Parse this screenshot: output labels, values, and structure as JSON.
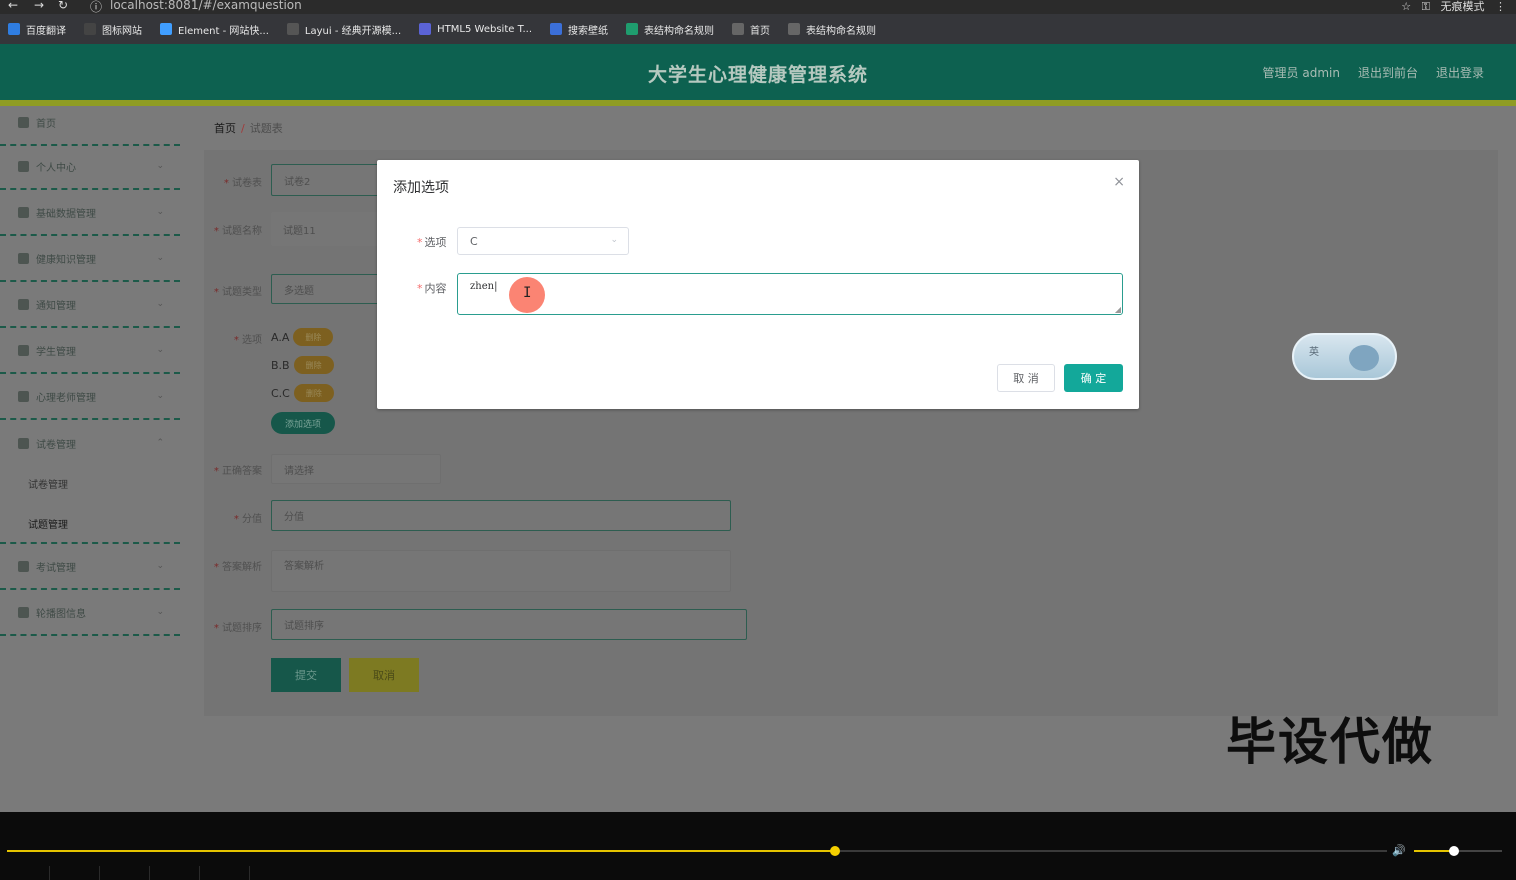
{
  "browser": {
    "url": "localhost:8081/#/examquestion",
    "profile": "无痕模式",
    "bookmarks": [
      {
        "label": "百度翻译",
        "color": "#2f7de1"
      },
      {
        "label": "图标网站",
        "color": "#444444"
      },
      {
        "label": "Element - 网站快...",
        "color": "#409eff"
      },
      {
        "label": "Layui - 经典开源模...",
        "color": "#555555"
      },
      {
        "label": "HTML5 Website T...",
        "color": "#5b63d6"
      },
      {
        "label": "搜索壁纸",
        "color": "#3b6fd8"
      },
      {
        "label": "表结构命名规则",
        "color": "#1f9d6e"
      },
      {
        "label": "首页",
        "color": "#666666"
      },
      {
        "label": "表结构命名规则",
        "color": "#666666"
      }
    ]
  },
  "header": {
    "title": "大学生心理健康管理系统",
    "user": "管理员 admin",
    "to_front": "退出到前台",
    "logout": "退出登录"
  },
  "sidebar": {
    "items": [
      {
        "label": "首页"
      },
      {
        "label": "个人中心"
      },
      {
        "label": "基础数据管理"
      },
      {
        "label": "健康知识管理"
      },
      {
        "label": "通知管理"
      },
      {
        "label": "学生管理"
      },
      {
        "label": "心理老师管理"
      },
      {
        "label": "试卷管理"
      },
      {
        "label": "考试管理"
      },
      {
        "label": "轮播图信息"
      }
    ],
    "sub_items": [
      "试卷管理",
      "试题管理"
    ]
  },
  "breadcrumb": {
    "home": "首页",
    "sep": "/",
    "current": "试题表"
  },
  "form": {
    "paper_label": "试卷表",
    "paper_value": "试卷2",
    "name_label": "试题名称",
    "name_value": "试题11",
    "type_label": "试题类型",
    "type_value": "多选题",
    "options_label": "选项",
    "options": [
      {
        "text": "A.A",
        "btn": "删除"
      },
      {
        "text": "B.B",
        "btn": "删除"
      },
      {
        "text": "C.C",
        "btn": "删除"
      }
    ],
    "add_option": "添加选项",
    "answer_label": "正确答案",
    "answer_placeholder": "请选择",
    "score_label": "分值",
    "score_placeholder": "分值",
    "analysis_label": "答案解析",
    "analysis_placeholder": "答案解析",
    "sort_label": "试题排序",
    "sort_placeholder": "试题排序",
    "submit": "提交",
    "cancel": "取消"
  },
  "modal": {
    "title": "添加选项",
    "close": "×",
    "option_label": "选项",
    "option_value": "C",
    "content_label": "内容",
    "content_value": "zhen",
    "cancel": "取 消",
    "ok": "确 定"
  },
  "ime": {
    "text": "英"
  },
  "watermark": "毕设代做",
  "player": {
    "progress": 0.6,
    "volume": 0.45
  },
  "colors": {
    "header": "#0d6150",
    "accent": "#8f9c23",
    "primary": "#13a89a"
  }
}
